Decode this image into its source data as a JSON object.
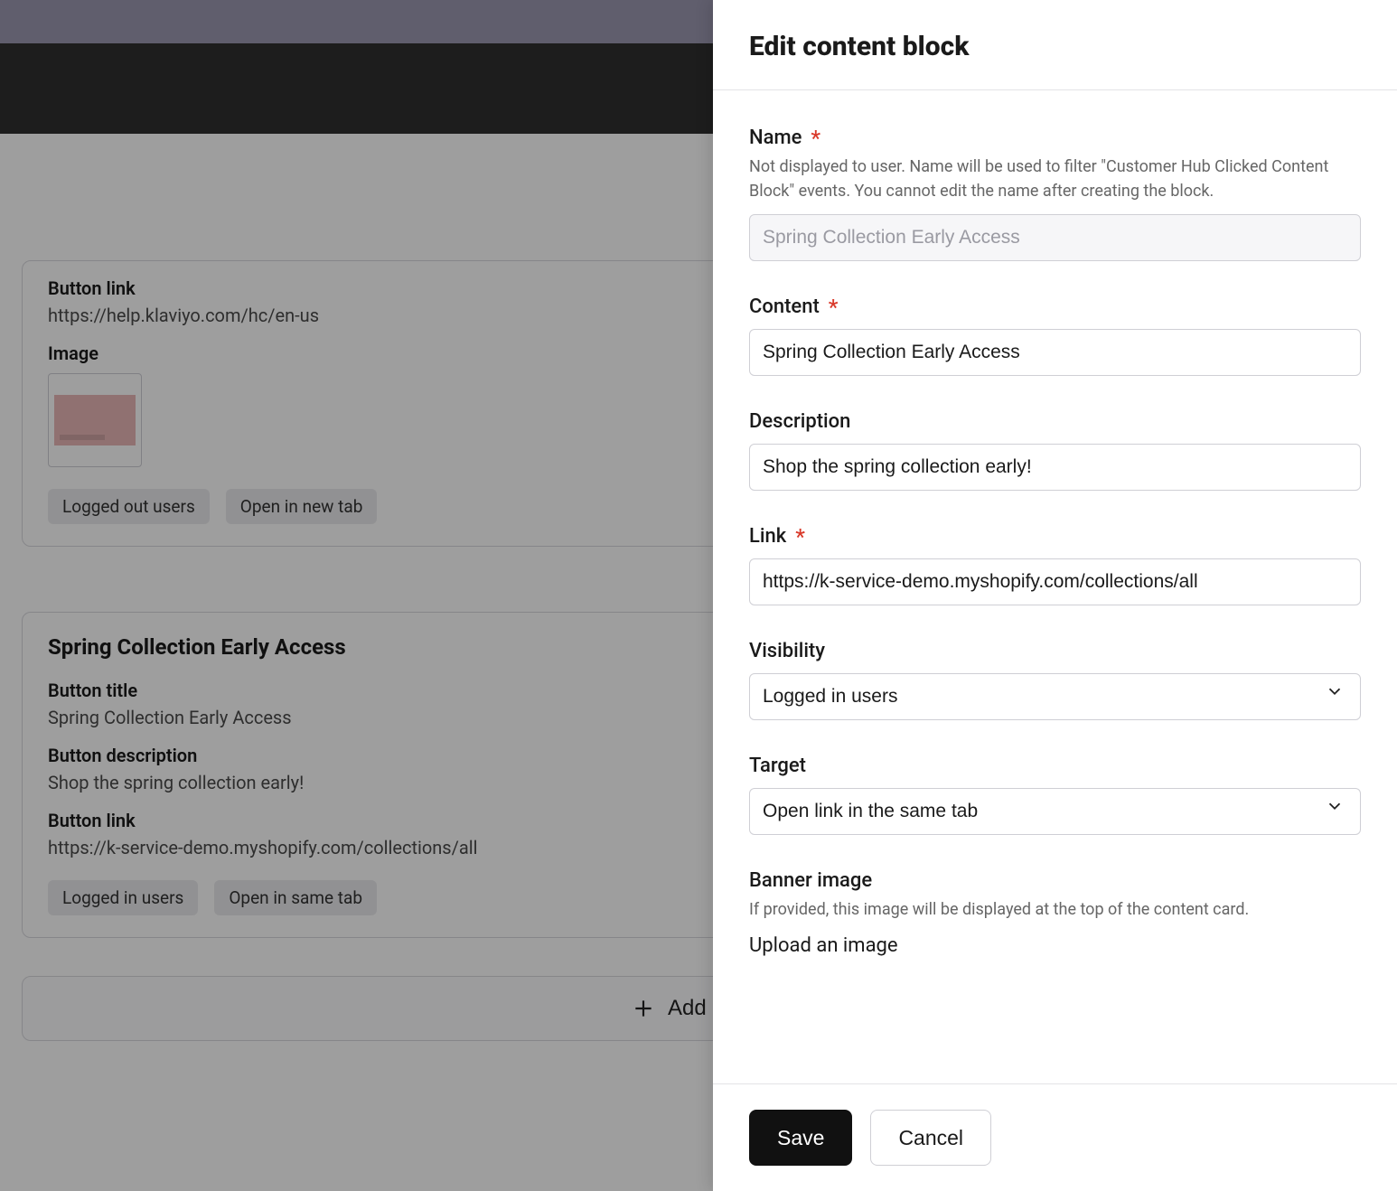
{
  "drawer": {
    "title": "Edit content block",
    "name": {
      "label": "Name",
      "help": "Not displayed to user. Name will be used to filter \"Customer Hub Clicked Content Block\" events. You cannot edit the name after creating the block.",
      "value": "Spring Collection Early Access"
    },
    "content": {
      "label": "Content",
      "value": "Spring Collection Early Access"
    },
    "description": {
      "label": "Description",
      "value": "Shop the spring collection early!"
    },
    "link": {
      "label": "Link",
      "value": "https://k-service-demo.myshopify.com/collections/all"
    },
    "visibility": {
      "label": "Visibility",
      "value": "Logged in users"
    },
    "target": {
      "label": "Target",
      "value": "Open link in the same tab"
    },
    "banner": {
      "label": "Banner image",
      "help": "If provided, this image will be displayed at the top of the content card.",
      "upload_label": "Upload an image"
    },
    "save_label": "Save",
    "cancel_label": "Cancel"
  },
  "cards": {
    "card1": {
      "button_link_label": "Button link",
      "button_link_value": "https://help.klaviyo.com/hc/en-us",
      "image_label": "Image",
      "chip_a": "Logged out users",
      "chip_b": "Open in new tab"
    },
    "card2": {
      "title": "Spring Collection Early Access",
      "button_title_label": "Button title",
      "button_title_value": "Spring Collection Early Access",
      "button_desc_label": "Button description",
      "button_desc_value": "Shop the spring collection early!",
      "button_link_label": "Button link",
      "button_link_value": "https://k-service-demo.myshopify.com/collections/all",
      "chip_a": "Logged in users",
      "chip_b": "Open in same tab"
    },
    "add_block_label": "Add Block"
  }
}
